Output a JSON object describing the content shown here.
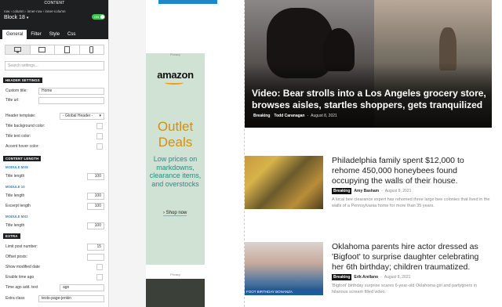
{
  "panel": {
    "header": "CONTENT",
    "breadcrumb": "row › column › inner-row › inner-column",
    "block_title": "Block 18",
    "toggle": "ON",
    "tabs": [
      "General",
      "Filter",
      "Style",
      "Css"
    ],
    "search_placeholder": "Search settings...",
    "sections": {
      "header": "HEADER SETTINGS",
      "content_length": "CONTENT LENGTH",
      "extra": "EXTRA"
    },
    "fields": {
      "custom_title": {
        "label": "Custom title:",
        "value": "Home"
      },
      "title_url": {
        "label": "Title url:",
        "value": ""
      },
      "header_template": {
        "label": "Header template:",
        "value": "- Global Header -"
      },
      "title_bg_color": {
        "label": "Title background color:"
      },
      "title_text_color": {
        "label": "Title text color:"
      },
      "accent_hover_color": {
        "label": "Accent hover color:"
      },
      "module_mx8": "MODULE MX8",
      "title_length_1": {
        "label": "Title length",
        "value": "100"
      },
      "module_10": "MODULE 10",
      "title_length_2": {
        "label": "Title length",
        "value": "100"
      },
      "excerpt_length": {
        "label": "Excerpt length",
        "value": "100"
      },
      "module_mx2": "MODULE MX2",
      "title_length_3": {
        "label": "Title length",
        "value": "100"
      },
      "limit_post_number": {
        "label": "Limit post number:",
        "value": "15"
      },
      "offset_posts": {
        "label": "Offset posts:",
        "value": ""
      },
      "show_modified_date": {
        "label": "Show modified date"
      },
      "enable_time_ago": {
        "label": "Enable time ago"
      },
      "time_ago_add_text": {
        "label": "Time ago add. text",
        "value": "ago"
      },
      "extra_class": {
        "label": "Extra class",
        "value": "tests-page-jenkin"
      }
    }
  },
  "ad": {
    "privacy": "Privacy",
    "brand": "amazon",
    "headline_1": "Outlet",
    "headline_2": "Deals",
    "body": "Low prices on markdowns, clearance items, and overstocks",
    "cta": "› Shop now",
    "privacy_bottom": "Privacy"
  },
  "hero": {
    "title": "Video: Bear strolls into a Los Angeles grocery store, browses aisles, startles shoppers, gets tranquilized",
    "category": "Breaking",
    "author": "Todd Caranagan",
    "date": "August 8, 2021"
  },
  "articles": [
    {
      "title": "Philadelphia family spent $12,000 to rehome 450,000 honeybees found occupying the walls of their house.",
      "category": "Breaking",
      "author": "Amy Basham",
      "date": "August 8, 2021",
      "excerpt": "A local bee clearance expert has rehomed three large bee colonies that lived in the walls of a Pennsylvania home for more than 35 years."
    },
    {
      "title": "Oklahoma parents hire actor dressed as 'Bigfoot' to surprise daughter celebrating her 6th birthday; children traumatized.",
      "category": "Breaking",
      "author": "Erik Arellano",
      "date": "August 8, 2021",
      "excerpt": "'Bigfoot' birthday surprise scares 6-year-old Oklahoma girl and partygoers in hilarious scream filled video.",
      "thumb_caption": "FOOT BIRTHDAY BONANZA"
    }
  ],
  "colors": {
    "panel_dark": "#1d1f21",
    "toggle_on": "#3ec24c",
    "ad_bg": "#cfe2d4",
    "ad_orange": "#d58e12",
    "ad_teal": "#2c8a87"
  }
}
